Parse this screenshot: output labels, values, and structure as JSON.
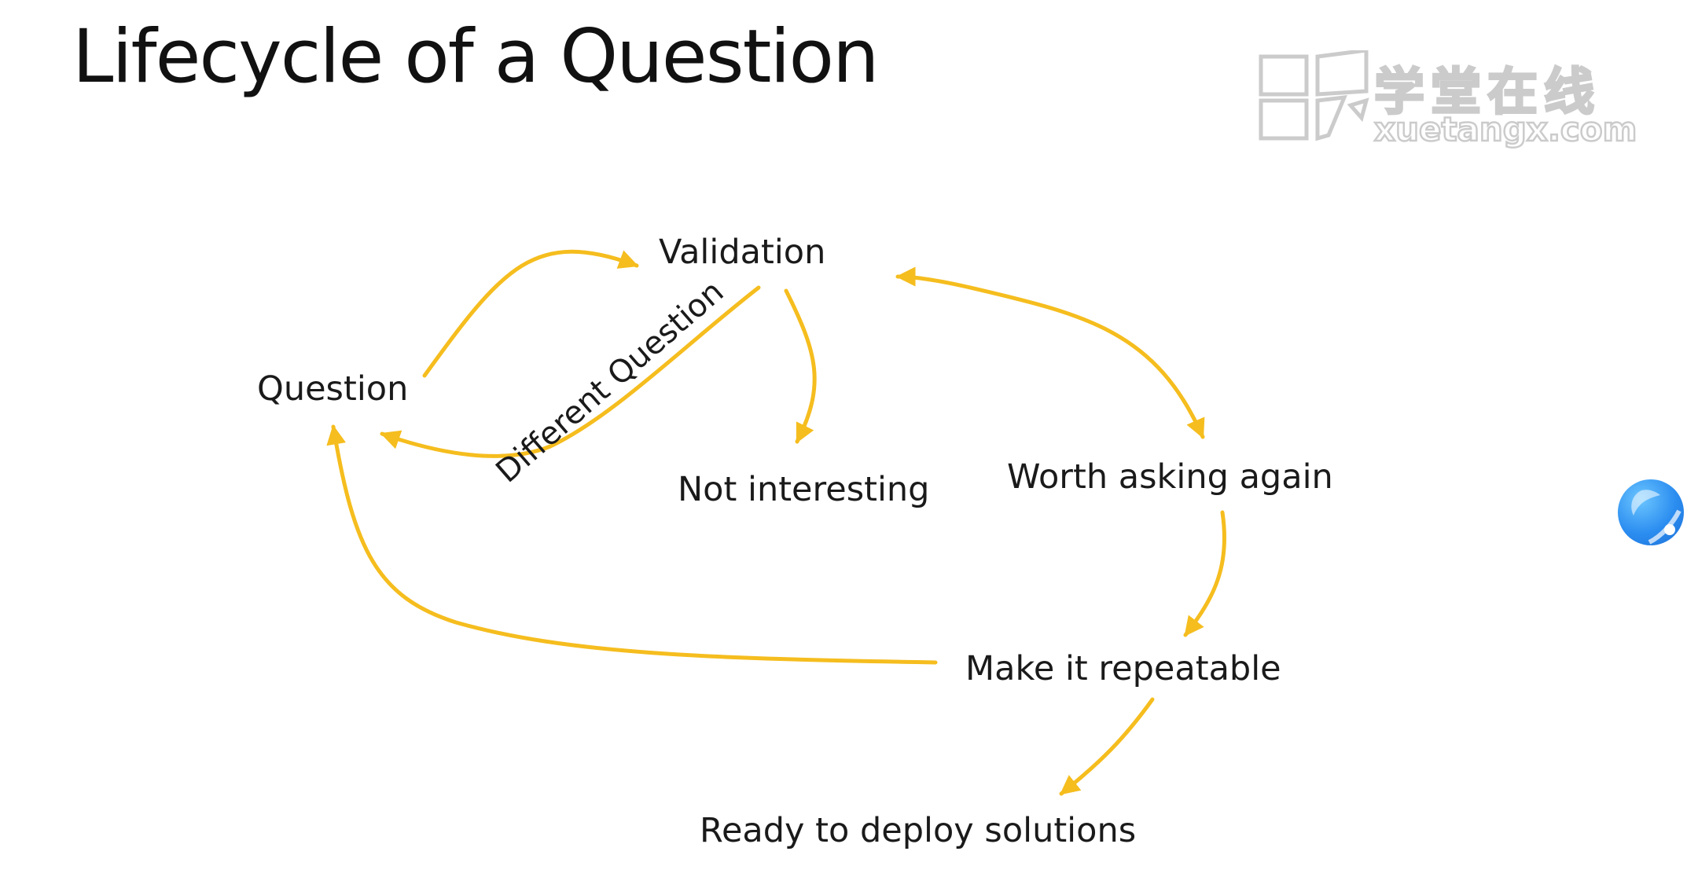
{
  "title": "Lifecycle of a Question",
  "watermark": {
    "cn": "学堂在线",
    "en": "xuetangx.com"
  },
  "nodes": {
    "question": "Question",
    "validation": "Validation",
    "not_interesting": "Not interesting",
    "worth_asking_again": "Worth asking again",
    "make_it_repeatable": "Make it repeatable",
    "ready_to_deploy": "Ready to deploy solutions"
  },
  "edge_labels": {
    "different_question": "Different Question"
  },
  "colors": {
    "arrow": "#F5BD1E",
    "text": "#1a1a1a"
  },
  "icons": {
    "assistant_bubble": "assistant-bubble-icon"
  }
}
